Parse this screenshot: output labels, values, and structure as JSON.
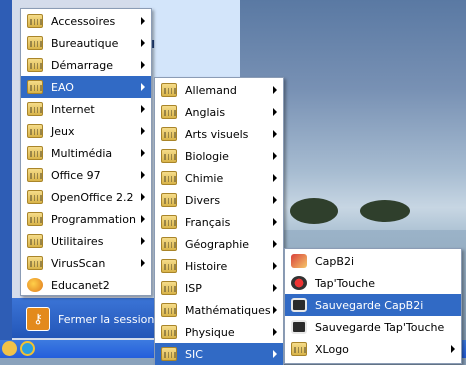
{
  "menu1": {
    "items": [
      {
        "label": "Accessoires",
        "icon": "folder-icon",
        "submenu": true
      },
      {
        "label": "Bureautique",
        "icon": "folder-icon",
        "submenu": true
      },
      {
        "label": "Démarrage",
        "icon": "folder-icon",
        "submenu": true
      },
      {
        "label": "EAO",
        "icon": "folder-icon",
        "submenu": true,
        "highlighted": true
      },
      {
        "label": "Internet",
        "icon": "folder-icon",
        "submenu": true
      },
      {
        "label": "Jeux",
        "icon": "folder-icon",
        "submenu": true
      },
      {
        "label": "Multimédia",
        "icon": "folder-icon",
        "submenu": true
      },
      {
        "label": "Office 97",
        "icon": "folder-icon",
        "submenu": true
      },
      {
        "label": "OpenOffice 2.2",
        "icon": "folder-icon",
        "submenu": true
      },
      {
        "label": "Programmation",
        "icon": "folder-icon",
        "submenu": true
      },
      {
        "label": "Utilitaires",
        "icon": "folder-icon",
        "submenu": true
      },
      {
        "label": "VirusScan",
        "icon": "folder-icon",
        "submenu": true
      },
      {
        "label": "Educanet2",
        "icon": "educanet-icon",
        "submenu": false
      }
    ]
  },
  "menu2": {
    "items": [
      {
        "label": "Allemand",
        "submenu": true
      },
      {
        "label": "Anglais",
        "submenu": true
      },
      {
        "label": "Arts visuels",
        "submenu": true
      },
      {
        "label": "Biologie",
        "submenu": true
      },
      {
        "label": "Chimie",
        "submenu": true
      },
      {
        "label": "Divers",
        "submenu": true
      },
      {
        "label": "Français",
        "submenu": true
      },
      {
        "label": "Géographie",
        "submenu": true
      },
      {
        "label": "Histoire",
        "submenu": true
      },
      {
        "label": "ISP",
        "submenu": true
      },
      {
        "label": "Mathématiques",
        "submenu": true
      },
      {
        "label": "Physique",
        "submenu": true
      },
      {
        "label": "SIC",
        "submenu": true,
        "highlighted": true
      }
    ]
  },
  "menu3": {
    "items": [
      {
        "label": "CapB2i",
        "icon": "capb2i-icon",
        "submenu": false
      },
      {
        "label": "Tap'Touche",
        "icon": "taptouche-icon",
        "submenu": false
      },
      {
        "label": "Sauvegarde CapB2i",
        "icon": "backup-icon",
        "submenu": false,
        "highlighted": true
      },
      {
        "label": "Sauvegarde Tap'Touche",
        "icon": "backup-icon",
        "submenu": false
      },
      {
        "label": "XLogo",
        "icon": "folder-icon",
        "submenu": true
      }
    ]
  },
  "start_panel": {
    "partial_label": "ail",
    "logoff_label": "Fermer la session"
  },
  "colors": {
    "highlight": "#316ac5",
    "menu_bg": "#ffffff",
    "taskbar": "#245edb"
  }
}
